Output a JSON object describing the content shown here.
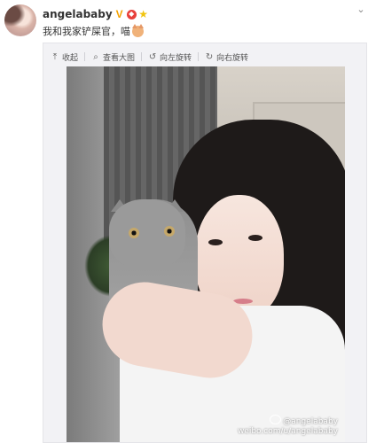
{
  "post": {
    "username": "angelababy",
    "badges": [
      "verified-v-badge",
      "red-tag-badge",
      "star-badge"
    ],
    "text": "我和我家铲屎官，喵",
    "text_emoji": "cat-face-emoji"
  },
  "toolbar": {
    "items": [
      {
        "label": "收起",
        "icon": "collapse-icon",
        "glyph": "⤒"
      },
      {
        "label": "查看大图",
        "icon": "magnify-icon",
        "glyph": "⌕"
      },
      {
        "label": "向左旋转",
        "icon": "rotate-left-icon",
        "glyph": "↺"
      },
      {
        "label": "向右旋转",
        "icon": "rotate-right-icon",
        "glyph": "↻"
      }
    ]
  },
  "image": {
    "watermark_handle": "@angelababy",
    "watermark_url": "weibo.com/u/angelababy"
  },
  "colors": {
    "username": "#333333",
    "card_bg": "#f2f2f5",
    "badge_v": "#f5a200"
  }
}
